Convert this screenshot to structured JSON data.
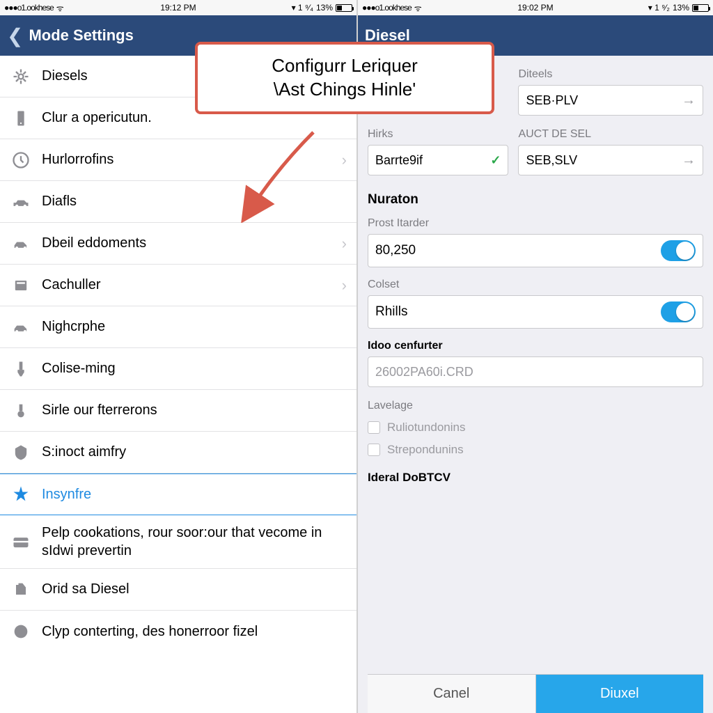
{
  "left": {
    "status": {
      "carrier": "●●●o1.ookhese",
      "time": "19:12 PM",
      "battery": "13%",
      "batt_ind": "▾ 1 ⁹⁄₄"
    },
    "nav": {
      "title": "Mode Settings"
    },
    "rows": [
      {
        "label": "Diesels",
        "chevron": false
      },
      {
        "label": "Clur a opericutun.",
        "chevron": false
      },
      {
        "label": "Hurlorrofins",
        "chevron": true
      },
      {
        "label": "Diafls",
        "chevron": false
      },
      {
        "label": "Dbeil eddoments",
        "chevron": true
      },
      {
        "label": "Cachuller",
        "chevron": true
      },
      {
        "label": "Nighcrphe",
        "chevron": false
      },
      {
        "label": "Colise-ming",
        "chevron": false
      },
      {
        "label": "Sirle our fterrerons",
        "chevron": false
      },
      {
        "label": "S:inoct aimfry",
        "chevron": false
      },
      {
        "label": "Insynfre",
        "chevron": false,
        "selected": true
      },
      {
        "label": "Pelp cookations, rour soor:our that vecome in sIdwi prevertin",
        "chevron": false,
        "multiline": true
      },
      {
        "label": "Orid sa Diesel",
        "chevron": false
      },
      {
        "label": "Clyp conterting, des honerroor fizel",
        "chevron": false,
        "last": true
      }
    ]
  },
  "right": {
    "status": {
      "carrier": "●●●o1.ookhese",
      "time": "19:02 PM",
      "battery": "13%",
      "batt_ind": "▾ 1 ⁹⁄₂"
    },
    "nav": {
      "title": "Diesel"
    },
    "top_left_label": "Hirks",
    "top_left_value": "Barrte9if",
    "top_right_label1": "Diteels",
    "top_right_value1": "SEB·PLV",
    "top_right_label2": "AUCT DE SEL",
    "top_right_value2": "SEB,SLV",
    "section": "Nuraton",
    "prost_label": "Prost Itarder",
    "prost_value": "80,250",
    "colset_label": "Colset",
    "colset_value": "Rhills",
    "idoo_label": "Idoo cenfurter",
    "idoo_value": "26002PA60i.CRD",
    "lavelage": "Lavelage",
    "opt1": "Ruliotundonins",
    "opt2": "Strepondunins",
    "ideral": "Ideral DoBTCV",
    "cancel": "Canel",
    "confirm": "Diuxel"
  },
  "callout": {
    "line1": "Configurr Leriquer",
    "line2": "\\Ast Chings Hinle'"
  }
}
